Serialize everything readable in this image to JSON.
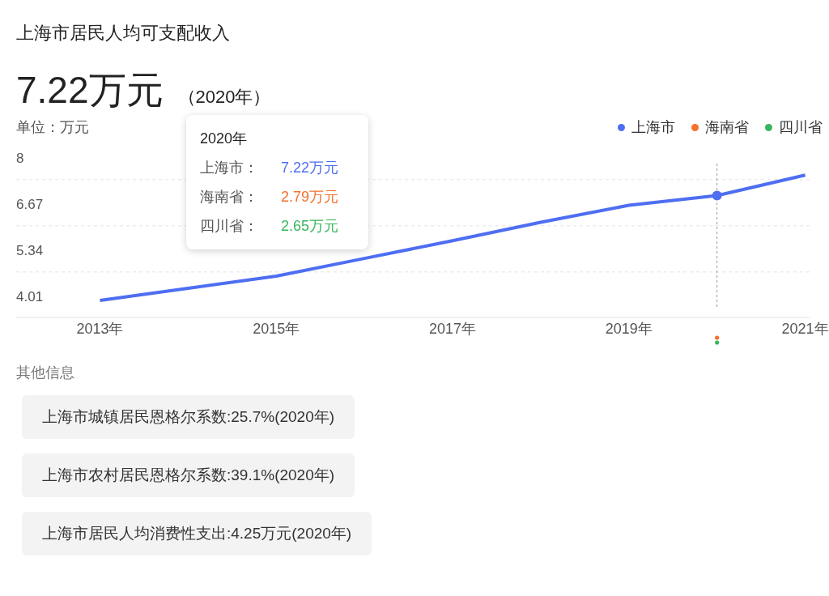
{
  "title": "上海市居民人均可支配收入",
  "headline": {
    "value": "7.22万元",
    "year": "（2020年）"
  },
  "unit": "单位：万元",
  "chart_data": {
    "type": "line",
    "x": [
      2013,
      2014,
      2015,
      2016,
      2017,
      2018,
      2019,
      2020,
      2021
    ],
    "xlim": [
      2012.05,
      2021.05
    ],
    "ylim": [
      3.4,
      8
    ],
    "ref_lines": [
      {
        "axis": "x",
        "value": 2020
      }
    ],
    "series": [
      {
        "name": "上海市",
        "color": "#4e6ef2",
        "values": [
          3.89,
          4.24,
          4.59,
          5.1,
          5.61,
          6.14,
          6.63,
          6.91,
          7.5
        ]
      },
      {
        "name": "海南省",
        "color": "#f5712c",
        "values": [
          null,
          null,
          null,
          null,
          null,
          null,
          null,
          null,
          null
        ]
      },
      {
        "name": "四川省",
        "color": "#3ab55d",
        "values": [
          null,
          null,
          null,
          null,
          null,
          null,
          null,
          null,
          null
        ]
      }
    ],
    "yticks": [
      4.01,
      5.34,
      6.67,
      8
    ],
    "xticks": [
      {
        "value": 2013,
        "label": "2013年"
      },
      {
        "value": 2015,
        "label": "2015年"
      },
      {
        "value": 2017,
        "label": "2017年"
      },
      {
        "value": 2019,
        "label": "2019年"
      },
      {
        "value": 2021,
        "label": "2021年"
      }
    ]
  },
  "tooltip": {
    "title": "2020年",
    "rows": [
      {
        "label": "上海市：",
        "value": "7.22万元",
        "color": "#4e6ef2"
      },
      {
        "label": "海南省：",
        "value": "2.79万元",
        "color": "#f5712c"
      },
      {
        "label": "四川省：",
        "value": "2.65万元",
        "color": "#3ab55d"
      }
    ]
  },
  "other_title": "其他信息",
  "other_items": [
    "上海市城镇居民恩格尔系数:25.7%(2020年)",
    "上海市农村居民恩格尔系数:39.1%(2020年)",
    "上海市居民人均消费性支出:4.25万元(2020年)"
  ]
}
